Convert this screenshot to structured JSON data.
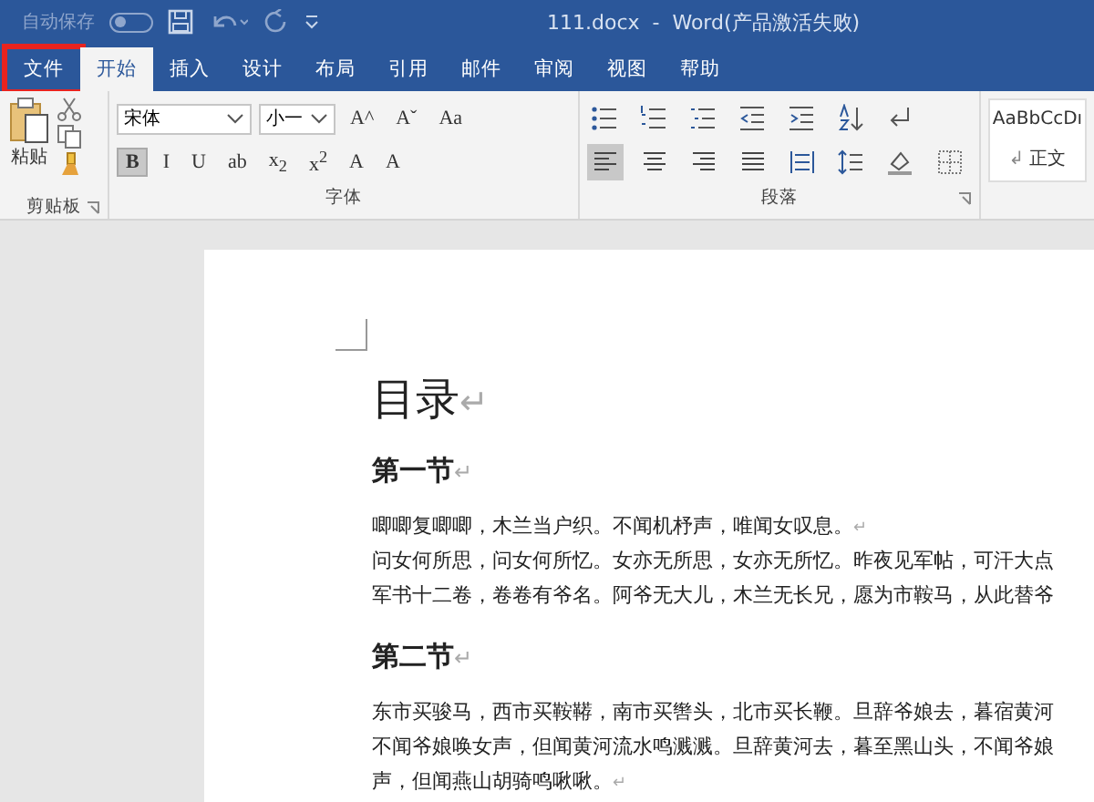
{
  "title_bar": {
    "autosave_label": "自动保存",
    "autosave_on": false,
    "title": "111.docx  -  Word(产品激活失败)"
  },
  "tabs": [
    {
      "label": "文件",
      "selected": false,
      "highlighted": true
    },
    {
      "label": "开始",
      "selected": true,
      "highlighted": false
    },
    {
      "label": "插入",
      "selected": false,
      "highlighted": false
    },
    {
      "label": "设计",
      "selected": false,
      "highlighted": false
    },
    {
      "label": "布局",
      "selected": false,
      "highlighted": false
    },
    {
      "label": "引用",
      "selected": false,
      "highlighted": false
    },
    {
      "label": "邮件",
      "selected": false,
      "highlighted": false
    },
    {
      "label": "审阅",
      "selected": false,
      "highlighted": false
    },
    {
      "label": "视图",
      "selected": false,
      "highlighted": false
    },
    {
      "label": "帮助",
      "selected": false,
      "highlighted": false
    }
  ],
  "clipboard": {
    "paste_label": "粘贴",
    "group_label": "剪贴板"
  },
  "font": {
    "font_name": "宋体",
    "font_size": "小一",
    "group_label": "字体",
    "row1": [
      {
        "kind": "text",
        "label": "A^",
        "selected": false
      },
      {
        "kind": "text",
        "label": "Aˇ",
        "selected": false
      },
      {
        "kind": "text",
        "label": "Aa",
        "selected": false
      }
    ],
    "row2": [
      {
        "kind": "text",
        "label": "B",
        "selected": true
      },
      {
        "kind": "text",
        "label": "I",
        "selected": false
      },
      {
        "kind": "text",
        "label": "U",
        "selected": false
      },
      {
        "kind": "text",
        "label": "ab",
        "selected": false
      },
      {
        "kind": "text",
        "label": "x$_{2}$",
        "selected": false
      },
      {
        "kind": "text",
        "label": "x$^{2}$",
        "selected": false
      },
      {
        "kind": "text",
        "label": "A",
        "selected": false
      },
      {
        "kind": "text",
        "label": "A",
        "selected": false
      }
    ]
  },
  "paragraph": {
    "group_label": "段落",
    "row1": [
      {
        "kind": "bullets",
        "selected": false
      },
      {
        "kind": "numbering",
        "selected": false
      },
      {
        "kind": "multilevel",
        "selected": false
      },
      {
        "kind": "outdent",
        "selected": false
      },
      {
        "kind": "indent",
        "selected": false
      },
      {
        "kind": "sort",
        "selected": false
      },
      {
        "kind": "marks",
        "selected": false
      }
    ],
    "row2": [
      {
        "kind": "align-left",
        "selected": true
      },
      {
        "kind": "align-center",
        "selected": false
      },
      {
        "kind": "align-right",
        "selected": false
      },
      {
        "kind": "justify",
        "selected": false
      },
      {
        "kind": "distribute",
        "selected": false
      },
      {
        "kind": "line-spacing",
        "selected": false
      },
      {
        "kind": "shading",
        "selected": false
      },
      {
        "kind": "borders",
        "selected": false
      }
    ]
  },
  "styles": {
    "preview": "AaBbCcDı",
    "mark": "↲",
    "name": "正文"
  },
  "document": [
    {
      "kind": "title",
      "text": "目录",
      "mark": "↵"
    },
    {
      "kind": "heading",
      "text": "第一节",
      "mark": "↵"
    },
    {
      "kind": "body",
      "text": "唧唧复唧唧，木兰当户织。不闻机杼声，唯闻女叹息。",
      "mark": "↵"
    },
    {
      "kind": "body",
      "text": "问女何所思，问女何所忆。女亦无所思，女亦无所忆。昨夜见军帖，可汗大点"
    },
    {
      "kind": "body",
      "text": "军书十二卷，卷卷有爷名。阿爷无大儿，木兰无长兄，愿为市鞍马，从此替爷"
    },
    {
      "kind": "heading",
      "text": "第二节",
      "mark": "↵"
    },
    {
      "kind": "body",
      "text": "东市买骏马，西市买鞍鞯，南市买辔头，北市买长鞭。旦辞爷娘去，暮宿黄河"
    },
    {
      "kind": "body",
      "text": "不闻爷娘唤女声，但闻黄河流水鸣溅溅。旦辞黄河去，暮至黑山头，不闻爷娘"
    },
    {
      "kind": "body",
      "text": "声，但闻燕山胡骑鸣啾啾。",
      "mark": "↵"
    }
  ]
}
